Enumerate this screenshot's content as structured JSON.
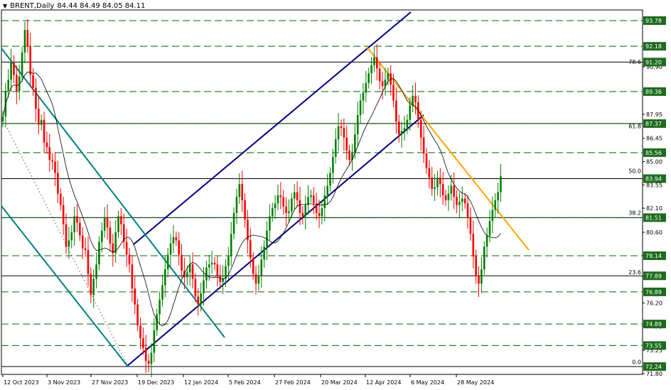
{
  "header": {
    "menu_icon": "triangle-down-icon",
    "symbol": "BRENT,Daily",
    "ohlc": "84.44 84.49 84.05 84.11"
  },
  "colors": {
    "bull": "#008000",
    "bear": "#ff0000",
    "ma": "#000000",
    "channel_blue": "#000080",
    "channel_teal": "#008080",
    "trend_orange": "#ffa500",
    "level_badge": "#1e6b1e",
    "grid": "#000000"
  },
  "chart_data": {
    "type": "candlestick",
    "price_range": [
      71.0,
      95.5
    ],
    "price_ticks": [
      "90.90",
      "87.95",
      "86.45",
      "85.00",
      "83.55",
      "82.10",
      "80.60",
      "79.15",
      "77.85",
      "76.20",
      "74.75",
      "73.25",
      "71.80"
    ],
    "date_ticks": [
      "12 Oct 2023",
      "3 Nov 2023",
      "27 Nov 2023",
      "19 Dec 2023",
      "12 Jan 2024",
      "5 Feb 2024",
      "27 Feb 2024",
      "20 Mar 2024",
      "12 Apr 2024",
      "6 May 2024",
      "28 May 2024"
    ],
    "level_labels": [
      {
        "value": 93.78,
        "label": "93.78"
      },
      {
        "value": 92.18,
        "label": "92.18"
      },
      {
        "value": 91.2,
        "label": "91.20"
      },
      {
        "value": 89.36,
        "label": "89.36"
      },
      {
        "value": 87.37,
        "label": "87.37"
      },
      {
        "value": 85.56,
        "label": "85.56"
      },
      {
        "value": 83.94,
        "label": "83.94"
      },
      {
        "value": 81.51,
        "label": "81.51"
      },
      {
        "value": 79.14,
        "label": "79.14"
      },
      {
        "value": 77.89,
        "label": "77.89"
      },
      {
        "value": 76.89,
        "label": "76.89"
      },
      {
        "value": 74.89,
        "label": "74.89"
      },
      {
        "value": 73.55,
        "label": "73.55"
      },
      {
        "value": 72.24,
        "label": "72.24"
      }
    ],
    "fib_levels": [
      {
        "value": 91.0,
        "label": "78.6"
      },
      {
        "value": 87.0,
        "label": "61.8"
      },
      {
        "value": 84.2,
        "label": "50.0"
      },
      {
        "value": 81.6,
        "label": "38.2"
      },
      {
        "value": 77.9,
        "label": "23.6"
      },
      {
        "value": 72.3,
        "label": "0.0"
      }
    ],
    "dashed_levels": [
      93.78,
      92.18,
      89.36,
      87.37,
      85.56,
      81.51,
      79.14,
      76.89,
      74.89,
      73.55
    ],
    "solid_levels": [
      91.2,
      87.37,
      83.94,
      81.51,
      77.89,
      72.24
    ],
    "closes": [
      87.8,
      89.4,
      90.1,
      91.2,
      90.4,
      89.4,
      90.3,
      91.8,
      93.2,
      92.2,
      90.4,
      89.6,
      88.3,
      87.3,
      87.6,
      86.2,
      85.9,
      85.1,
      85.0,
      84.3,
      83.0,
      82.3,
      81.1,
      79.7,
      80.1,
      80.6,
      81.6,
      81.2,
      80.4,
      79.6,
      79.5,
      78.0,
      76.7,
      77.7,
      78.6,
      80.0,
      80.7,
      81.5,
      80.9,
      79.9,
      79.3,
      80.6,
      81.6,
      81.1,
      80.0,
      79.2,
      78.6,
      77.1,
      76.1,
      74.8,
      74.0,
      73.4,
      72.6,
      72.4,
      73.1,
      74.5,
      75.5,
      76.4,
      77.3,
      78.3,
      79.2,
      79.9,
      80.3,
      80.1,
      79.2,
      78.2,
      77.8,
      78.1,
      78.6,
      77.7,
      76.6,
      76.1,
      76.8,
      77.6,
      78.4,
      78.6,
      78.7,
      78.6,
      77.9,
      77.5,
      77.7,
      78.5,
      79.1,
      80.5,
      81.8,
      82.8,
      83.6,
      82.6,
      81.4,
      80.1,
      79.0,
      78.0,
      77.4,
      77.9,
      78.9,
      79.7,
      80.7,
      81.6,
      82.1,
      82.4,
      82.9,
      82.8,
      82.2,
      81.8,
      81.9,
      82.7,
      83.1,
      82.6,
      81.8,
      81.6,
      82.3,
      82.8,
      82.9,
      82.4,
      81.8,
      81.6,
      82.1,
      82.9,
      83.5,
      84.3,
      85.3,
      86.4,
      87.2,
      87.1,
      86.5,
      85.7,
      85.1,
      85.6,
      86.7,
      87.9,
      88.8,
      89.3,
      89.9,
      90.5,
      91.0,
      91.5,
      90.8,
      90.0,
      89.7,
      90.1,
      90.5,
      89.8,
      88.8,
      87.5,
      86.7,
      86.9,
      87.1,
      87.6,
      88.5,
      89.1,
      88.7,
      87.6,
      86.5,
      85.5,
      84.6,
      84.0,
      83.3,
      83.4,
      84.0,
      83.6,
      82.9,
      82.6,
      83.0,
      83.5,
      82.8,
      82.3,
      82.5,
      82.7,
      82.4,
      81.5,
      80.5,
      79.1,
      77.9,
      77.4,
      78.3,
      79.7,
      80.4,
      81.3,
      82.0,
      82.6,
      83.1,
      84.1
    ]
  }
}
